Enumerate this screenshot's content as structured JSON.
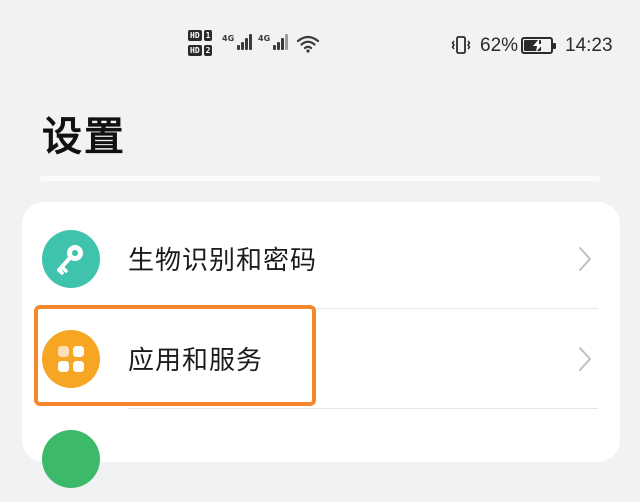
{
  "status_bar": {
    "sim1_label": "HD",
    "sim1_number": "1",
    "sim2_label": "HD",
    "sim2_number": "2",
    "net1_type": "4G",
    "net2_type": "4G",
    "battery_percent": "62%",
    "battery_level": 0.62,
    "time": "14:23",
    "icons": [
      "vibrate-icon",
      "wifi-icon",
      "battery-charging-icon"
    ]
  },
  "page": {
    "title": "设置"
  },
  "settings_list": [
    {
      "label": "生物识别和密码",
      "icon": "key-icon",
      "icon_color": "#3fc3ad"
    },
    {
      "label": "应用和服务",
      "icon": "apps-grid-icon",
      "icon_color": "#f6a623"
    }
  ],
  "highlight_color": "#f5872d"
}
